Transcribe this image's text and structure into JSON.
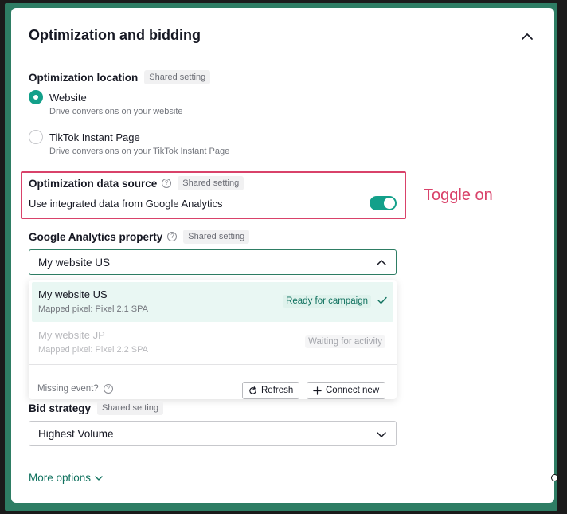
{
  "panel": {
    "title": "Optimization and bidding"
  },
  "location": {
    "label": "Optimization location",
    "badge": "Shared setting",
    "options": [
      {
        "title": "Website",
        "desc": "Drive conversions on your website",
        "checked": true
      },
      {
        "title": "TikTok Instant Page",
        "desc": "Drive conversions on your TikTok Instant Page",
        "checked": false
      }
    ]
  },
  "data_source": {
    "label": "Optimization data source",
    "badge": "Shared setting",
    "toggle_text": "Use integrated data from Google Analytics",
    "toggle_on": true
  },
  "annotation": {
    "text": "Toggle on",
    "color": "#d9426a"
  },
  "ga_property": {
    "label": "Google Analytics property",
    "badge": "Shared setting",
    "selected": "My website US",
    "items": [
      {
        "name": "My website US",
        "sub": "Mapped pixel: Pixel 2.1 SPA",
        "status": "Ready for campaign",
        "selected": true
      },
      {
        "name": "My website JP",
        "sub": "Mapped pixel: Pixel 2.2 SPA",
        "status": "Waiting for activity",
        "selected": false
      }
    ],
    "missing_text": "Missing event?",
    "refresh_label": "Refresh",
    "connect_label": "Connect new"
  },
  "bid": {
    "label": "Bid strategy",
    "badge": "Shared setting",
    "selected": "Highest Volume"
  },
  "more_options": "More options",
  "colors": {
    "accent": "#13a08a",
    "link": "#11725f",
    "frame": "#2e7d64"
  }
}
